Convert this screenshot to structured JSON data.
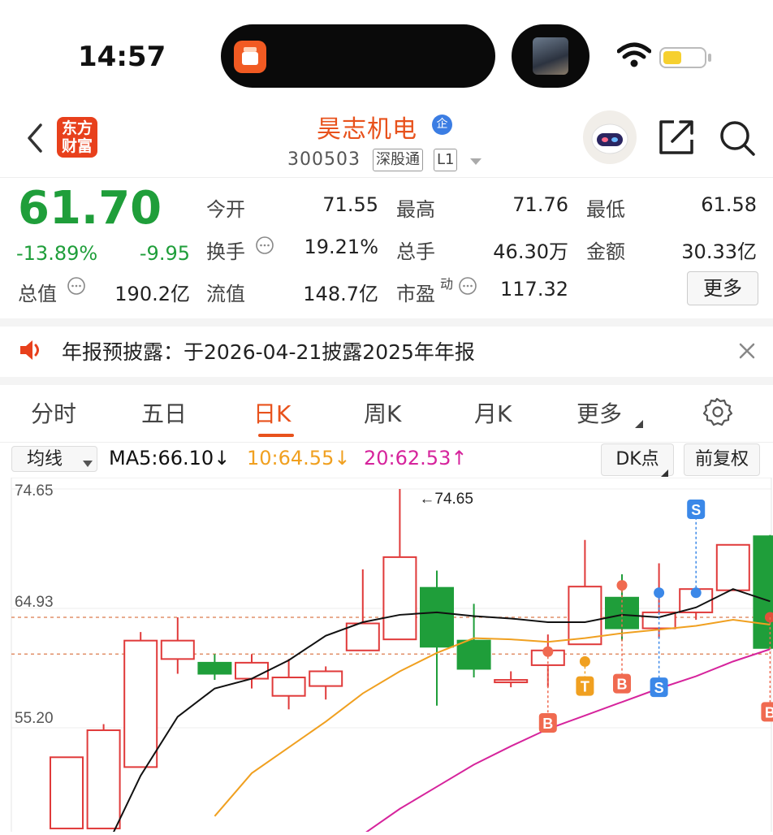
{
  "status_bar": {
    "time": "14:57"
  },
  "header": {
    "stock_name": "昊志机电",
    "corp_badge": "企",
    "stock_code": "300503",
    "tag_connect": "深股通",
    "tag_level": "L1",
    "logo_line1": "东方",
    "logo_line2": "财富"
  },
  "quote": {
    "price": "61.70",
    "change_pct": "-13.89%",
    "change_abs": "-9.95",
    "open_label": "今开",
    "open_value": "71.55",
    "high_label": "最高",
    "high_value": "71.76",
    "low_label": "最低",
    "low_value": "61.58",
    "turnover_label": "换手",
    "turnover_value": "19.21%",
    "volume_label": "总手",
    "volume_value": "46.30万",
    "amount_label": "金额",
    "amount_value": "30.33亿",
    "mktcap_label": "总值",
    "mktcap_value": "190.2亿",
    "float_label": "流值",
    "float_value": "148.7亿",
    "pe_label": "市盈",
    "pe_sup": "动",
    "pe_value": "117.32",
    "more_label": "更多"
  },
  "notice": {
    "text": "年报预披露：于2026-04-21披露2025年年报"
  },
  "tabs": [
    "分时",
    "五日",
    "日K",
    "周K",
    "月K",
    "更多"
  ],
  "active_tab": "日K",
  "controls": {
    "ma_select": "均线",
    "ma5": "MA5:66.10↓",
    "ma10": "10:64.55↓",
    "ma20": "20:62.53↑",
    "dk_label": "DK点",
    "adjust_label": "前复权"
  },
  "colors": {
    "up": "#e03a3a",
    "down": "#1f9e3a",
    "accent": "#e8521c",
    "ma5": "#111111",
    "ma10": "#f0a020",
    "ma20": "#d6249c"
  },
  "icons": [
    "back-icon",
    "speaker-icon",
    "close-icon",
    "settings-gear-icon",
    "share-icon",
    "search-icon",
    "wifi-icon",
    "battery-icon",
    "robot-avatar-icon"
  ],
  "chart_data": {
    "type": "candlestick",
    "y_ticks": [
      "74.65",
      "64.93",
      "55.20"
    ],
    "ylim": [
      55.2,
      74.65
    ],
    "high_annotation": "←74.65",
    "candles": [
      {
        "o": 47.0,
        "h": 52.8,
        "l": 47.0,
        "c": 52.8
      },
      {
        "o": 47.0,
        "h": 55.5,
        "l": 47.0,
        "c": 55.0
      },
      {
        "o": 52.0,
        "h": 63.0,
        "l": 52.0,
        "c": 62.3
      },
      {
        "o": 60.8,
        "h": 64.2,
        "l": 59.6,
        "c": 62.3
      },
      {
        "o": 60.5,
        "h": 61.2,
        "l": 59.1,
        "c": 59.6
      },
      {
        "o": 59.2,
        "h": 61.2,
        "l": 58.4,
        "c": 60.5
      },
      {
        "o": 57.8,
        "h": 60.8,
        "l": 56.7,
        "c": 59.3
      },
      {
        "o": 58.6,
        "h": 60.2,
        "l": 57.5,
        "c": 59.8
      },
      {
        "o": 61.5,
        "h": 68.1,
        "l": 61.5,
        "c": 63.7
      },
      {
        "o": 62.4,
        "h": 74.65,
        "l": 62.4,
        "c": 69.1
      },
      {
        "o": 66.6,
        "h": 68.0,
        "l": 57.0,
        "c": 61.8
      },
      {
        "o": 62.3,
        "h": 65.3,
        "l": 59.3,
        "c": 60.0
      },
      {
        "o": 59.1,
        "h": 59.8,
        "l": 58.5,
        "c": 59.1
      },
      {
        "o": 60.3,
        "h": 62.8,
        "l": 58.5,
        "c": 61.5
      },
      {
        "o": 62.0,
        "h": 70.5,
        "l": 62.0,
        "c": 66.7
      },
      {
        "o": 65.8,
        "h": 67.7,
        "l": 62.3,
        "c": 63.3
      },
      {
        "o": 63.3,
        "h": 68.6,
        "l": 62.5,
        "c": 64.6
      },
      {
        "o": 64.6,
        "h": 66.6,
        "l": 64.0,
        "c": 66.5
      },
      {
        "o": 66.4,
        "h": 70.1,
        "l": 66.4,
        "c": 70.1
      },
      {
        "o": 70.8,
        "h": 70.9,
        "l": 61.6,
        "c": 61.7
      }
    ],
    "ma5": [
      null,
      45.0,
      51.3,
      56.1,
      58.4,
      59.2,
      60.7,
      62.7,
      63.8,
      64.4,
      64.6,
      64.3,
      64.1,
      63.8,
      63.8,
      64.4,
      64.2,
      65.0,
      66.5,
      65.5
    ],
    "ma10": [
      null,
      null,
      null,
      null,
      48.0,
      51.5,
      53.6,
      55.7,
      58.0,
      59.8,
      61.3,
      62.5,
      62.4,
      62.2,
      62.5,
      62.9,
      63.2,
      63.5,
      64.0,
      63.6
    ],
    "ma20": [
      null,
      null,
      null,
      null,
      null,
      null,
      null,
      null,
      46.5,
      48.6,
      50.4,
      52.2,
      53.7,
      55.1,
      56.2,
      57.3,
      58.4,
      59.4,
      60.6,
      61.6
    ],
    "dashed_levels": [
      64.2,
      61.2
    ],
    "markers": [
      {
        "i": 13,
        "kind": "dot",
        "color": "#f06a50",
        "price": 61.4
      },
      {
        "i": 13,
        "kind": "tag",
        "label": "B",
        "color": "#f06a50",
        "price": 55.6
      },
      {
        "i": 14,
        "kind": "dot",
        "color": "#f0a020",
        "price": 60.6
      },
      {
        "i": 14,
        "kind": "tag",
        "label": "T",
        "color": "#f0a020",
        "price": 58.6
      },
      {
        "i": 15,
        "kind": "dot",
        "color": "#f06a50",
        "price": 66.8
      },
      {
        "i": 15,
        "kind": "tag",
        "label": "B",
        "color": "#f06a50",
        "price": 58.8
      },
      {
        "i": 16,
        "kind": "dot",
        "color": "#3b88e8",
        "price": 66.2
      },
      {
        "i": 16,
        "kind": "tag",
        "label": "S",
        "color": "#3b88e8",
        "price": 58.5
      },
      {
        "i": 17,
        "kind": "dot",
        "color": "#3b88e8",
        "price": 66.2
      },
      {
        "i": 17,
        "kind": "tag",
        "label": "S",
        "color": "#3b88e8",
        "price": 73.0
      },
      {
        "i": 19,
        "kind": "dot",
        "color": "#e0503a",
        "price": 64.2
      },
      {
        "i": 19,
        "kind": "tag",
        "label": "B",
        "color": "#f06a50",
        "price": 56.5
      }
    ]
  }
}
